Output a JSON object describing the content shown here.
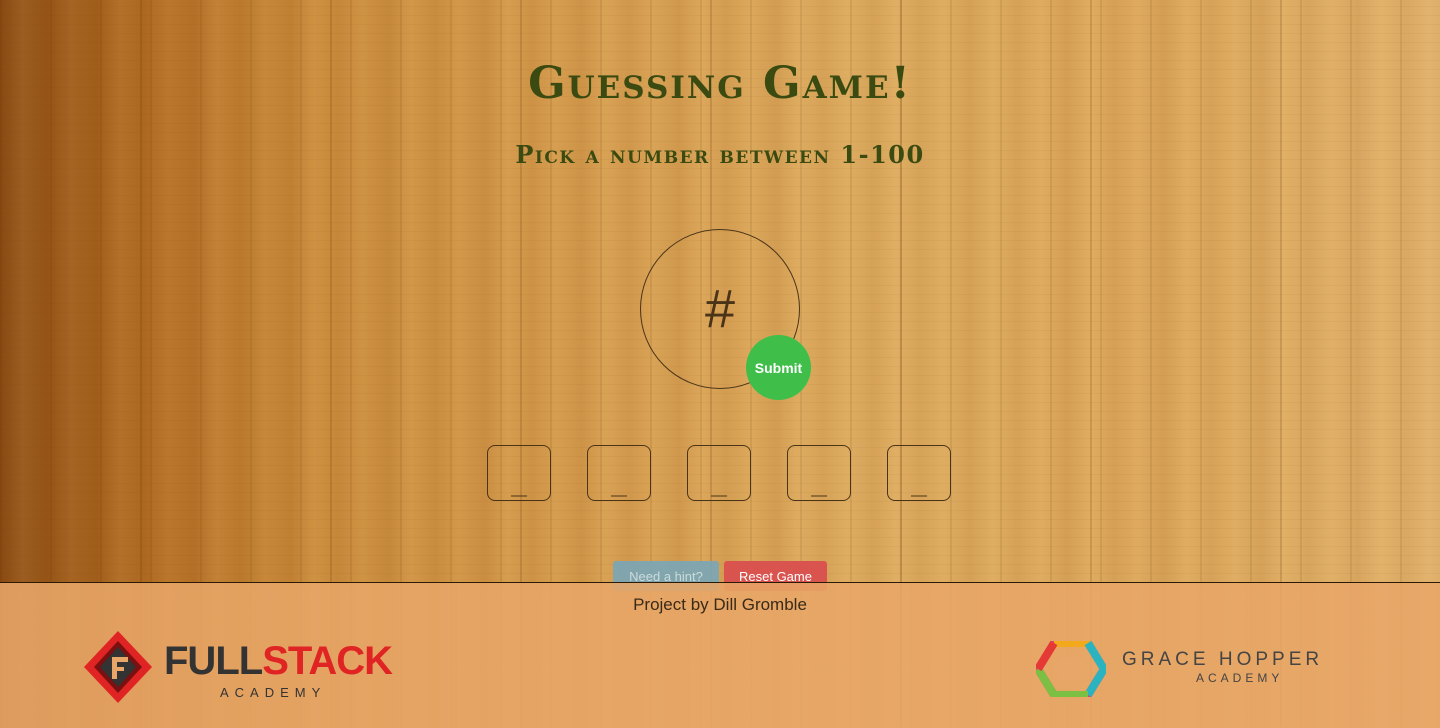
{
  "header": {
    "title": "Guessing Game!",
    "subtitle": "Pick a number between 1-100"
  },
  "guess": {
    "placeholder": "#",
    "submit_label": "Submit"
  },
  "guess_slots": [
    "_",
    "_",
    "_",
    "_",
    "_"
  ],
  "actions": {
    "hint_label": "Need a hint?",
    "reset_label": "Reset Game"
  },
  "footer": {
    "credit": "Project by Dill Gromble",
    "fullstack_logo": {
      "word_dark": "FULL",
      "word_red": "STACK",
      "sub": "ACADEMY"
    },
    "gracehopper_logo": {
      "word": "GRACE HOPPER",
      "sub": "ACADEMY"
    }
  },
  "colors": {
    "title_text": "#3a4a10",
    "submit_bg": "#3fbf4a",
    "hint_bg": "#7aa7b8",
    "reset_bg": "#d9534f"
  }
}
